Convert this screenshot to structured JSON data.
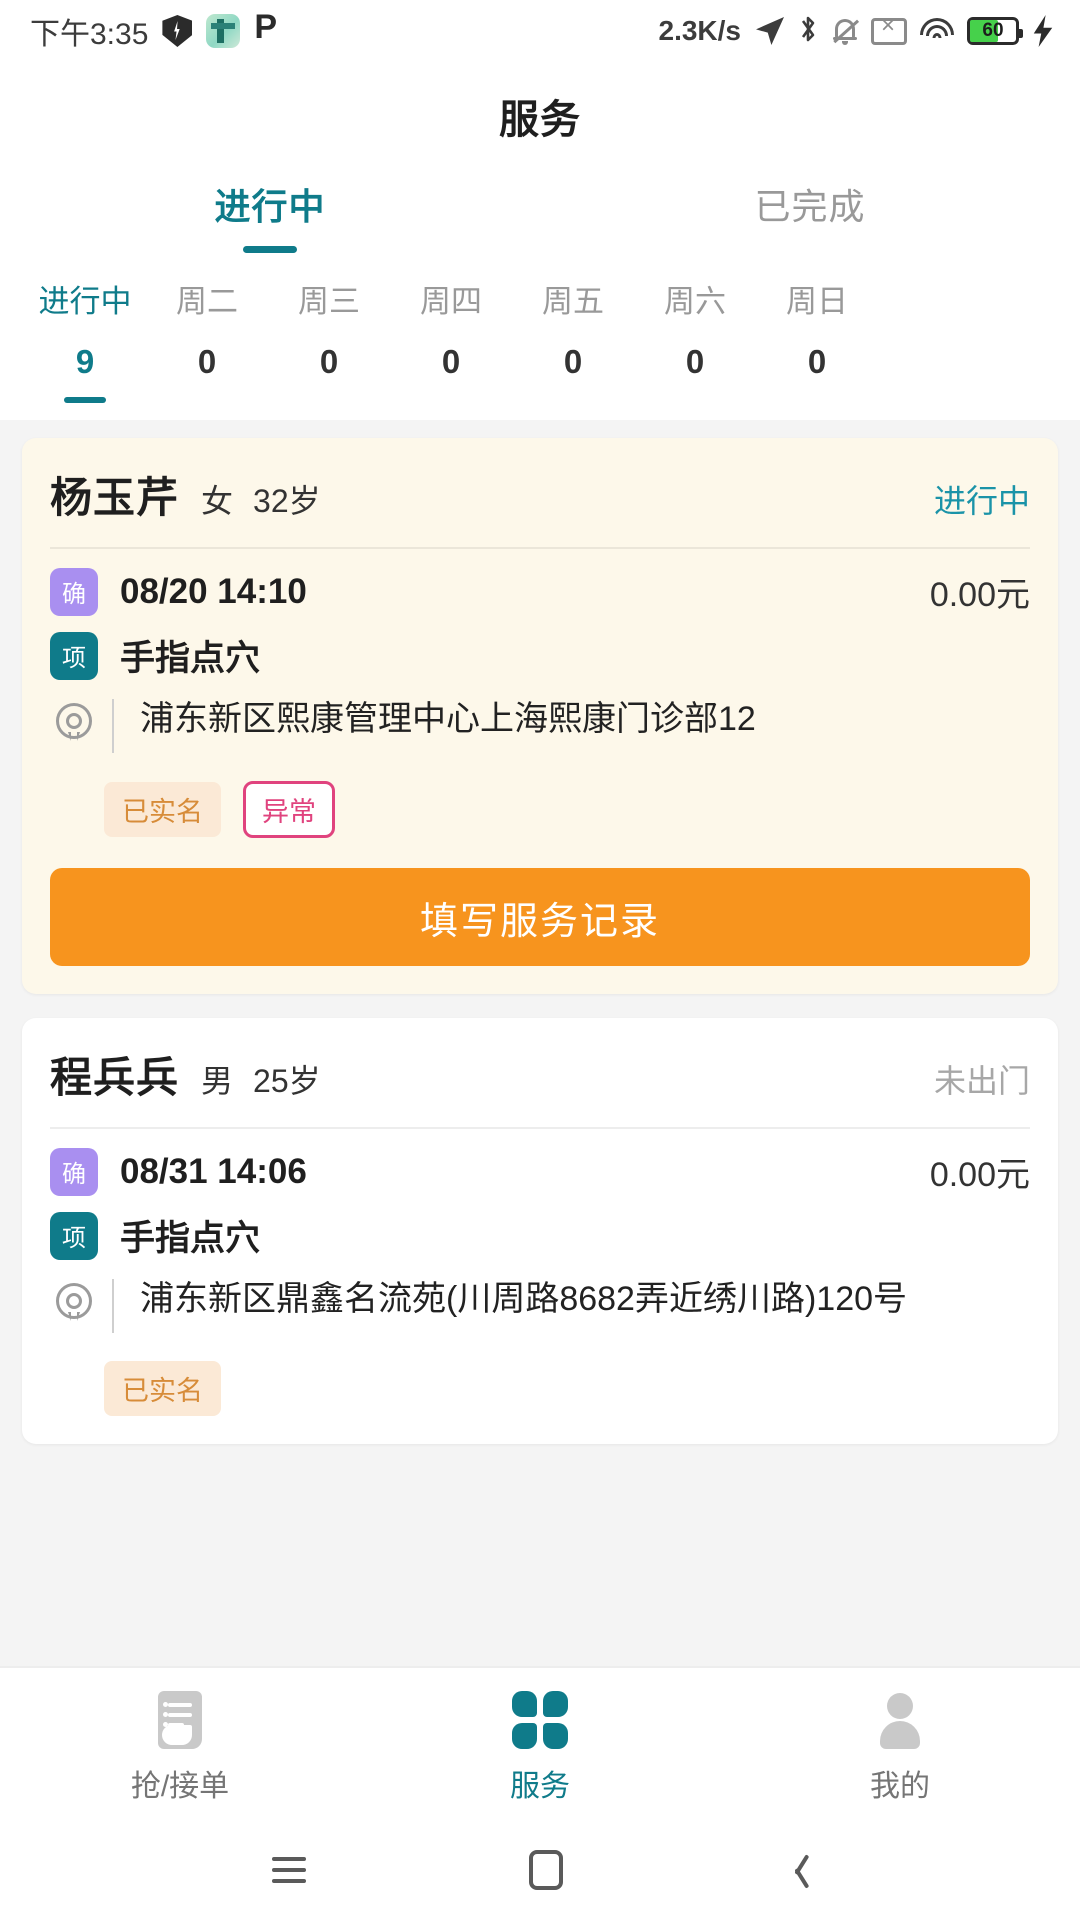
{
  "statusbar": {
    "time": "下午3:35",
    "network_speed": "2.3K/s",
    "battery_level": "60",
    "icons": [
      "shield-bolt-icon",
      "app-icon",
      "p-icon",
      "location-arrow-icon",
      "bluetooth-icon",
      "bell-muted-icon",
      "sim-disabled-icon",
      "wifi-icon",
      "battery-icon",
      "charging-bolt-icon"
    ]
  },
  "header": {
    "title": "服务"
  },
  "main_tabs": [
    {
      "label": "进行中",
      "active": true
    },
    {
      "label": "已完成",
      "active": false
    }
  ],
  "day_tabs": [
    {
      "label": "进行中",
      "count": "9",
      "active": true
    },
    {
      "label": "周二",
      "count": "0",
      "active": false
    },
    {
      "label": "周三",
      "count": "0",
      "active": false
    },
    {
      "label": "周四",
      "count": "0",
      "active": false
    },
    {
      "label": "周五",
      "count": "0",
      "active": false
    },
    {
      "label": "周六",
      "count": "0",
      "active": false
    },
    {
      "label": "周日",
      "count": "0",
      "active": false
    }
  ],
  "cards": [
    {
      "name": "杨玉芹",
      "sex": "女",
      "age": "32岁",
      "status": "进行中",
      "confirm_badge": "确",
      "datetime": "08/20 14:10",
      "price": "0.00元",
      "project_badge": "项",
      "project": "手指点穴",
      "address": "浦东新区熙康管理中心上海熙康门诊部12",
      "tags": [
        "已实名",
        "异常"
      ],
      "action_label": "填写服务记录"
    },
    {
      "name": "程兵兵",
      "sex": "男",
      "age": "25岁",
      "status": "未出门",
      "confirm_badge": "确",
      "datetime": "08/31 14:06",
      "price": "0.00元",
      "project_badge": "项",
      "project": "手指点穴",
      "address": "浦东新区鼎鑫名流苑(川周路8682弄近绣川路)120号",
      "tags": [
        "已实名"
      ]
    }
  ],
  "bottom_nav": [
    {
      "label": "抢/接单",
      "active": false
    },
    {
      "label": "服务",
      "active": true
    },
    {
      "label": "我的",
      "active": false
    }
  ],
  "colors": {
    "accent_teal": "#0f7b8a",
    "action_orange": "#f7941e",
    "tag_orange": "#d78c39",
    "tag_pink": "#e0437e",
    "badge_purple": "#a98ff0",
    "highlight_card_bg": "#fdf8ea"
  }
}
